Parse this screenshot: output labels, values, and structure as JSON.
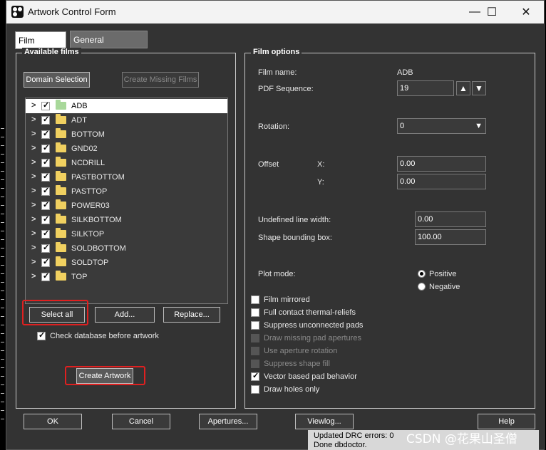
{
  "window": {
    "title": "Artwork Control Form",
    "controls": {
      "minimize": "—",
      "maximize": "☐",
      "close": "✕"
    }
  },
  "tabs": [
    {
      "label": "Film Control"
    },
    {
      "label": "General Parameters"
    }
  ],
  "available_films": {
    "title": "Available films",
    "domain_selection": "Domain Selection",
    "create_missing": "Create Missing Films",
    "films": [
      {
        "name": "ADB",
        "checked": true
      },
      {
        "name": "ADT",
        "checked": true
      },
      {
        "name": "BOTTOM",
        "checked": true
      },
      {
        "name": "GND02",
        "checked": true
      },
      {
        "name": "NCDRILL",
        "checked": true
      },
      {
        "name": "PASTBOTTOM",
        "checked": true
      },
      {
        "name": "PASTTOP",
        "checked": true
      },
      {
        "name": "POWER03",
        "checked": true
      },
      {
        "name": "SILKBOTTOM",
        "checked": true
      },
      {
        "name": "SILKTOP",
        "checked": true
      },
      {
        "name": "SOLDBOTTOM",
        "checked": true
      },
      {
        "name": "SOLDTOP",
        "checked": true
      },
      {
        "name": "TOP",
        "checked": true
      }
    ],
    "expander_glyph": ">",
    "select_all": "Select all",
    "add": "Add...",
    "replace": "Replace...",
    "check_db": "Check database before artwork",
    "create_artwork": "Create Artwork"
  },
  "film_options": {
    "title": "Film options",
    "film_name_label": "Film name:",
    "film_name_value": "ADB",
    "pdf_sequence_label": "PDF Sequence:",
    "pdf_sequence_value": "19",
    "spin_up": "⌃",
    "spin_down": "⌄",
    "rotation_label": "Rotation:",
    "rotation_value": "0",
    "offset_label": "Offset",
    "x_label": "X:",
    "x_value": "0.00",
    "y_label": "Y:",
    "y_value": "0.00",
    "undef_width_label": "Undefined line width:",
    "undef_width_value": "0.00",
    "shape_bbox_label": "Shape bounding box:",
    "shape_bbox_value": "100.00",
    "plot_mode_label": "Plot mode:",
    "positive": "Positive",
    "negative": "Negative",
    "options": [
      {
        "label": "Film mirrored",
        "checked": false,
        "enabled": true
      },
      {
        "label": "Full contact thermal-reliefs",
        "checked": false,
        "enabled": true
      },
      {
        "label": "Suppress unconnected pads",
        "checked": false,
        "enabled": true
      },
      {
        "label": "Draw missing pad apertures",
        "checked": false,
        "enabled": false
      },
      {
        "label": "Use aperture rotation",
        "checked": false,
        "enabled": false
      },
      {
        "label": "Suppress shape fill",
        "checked": false,
        "enabled": false
      },
      {
        "label": "Vector based pad behavior",
        "checked": true,
        "enabled": true
      },
      {
        "label": "Draw holes only",
        "checked": false,
        "enabled": true
      }
    ]
  },
  "footer": {
    "ok": "OK",
    "cancel": "Cancel",
    "apertures": "Apertures...",
    "viewlog": "Viewlog...",
    "help": "Help"
  },
  "status": {
    "line1": "Updated DRC errors:  0",
    "line2": "Done dbdoctor."
  },
  "watermark": "CSDN @花果山圣僧",
  "colors": {
    "highlight": "#e02020",
    "panel_bg": "#333333"
  }
}
